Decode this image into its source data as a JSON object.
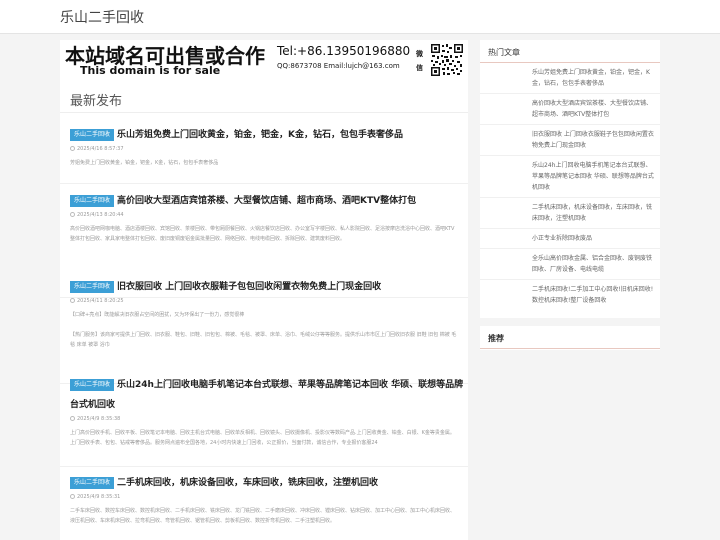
{
  "site": {
    "title": "乐山二手回收"
  },
  "banner": {
    "cn": "本站域名可出售或合作",
    "en": "This domain is for sale",
    "tel": "Tel:+86.13950196880",
    "qq": "QQ:8673708 Email:lujch@163.com",
    "wechat": "微信"
  },
  "section": {
    "title": "最新发布"
  },
  "articles": [
    {
      "tag": "乐山二手回收",
      "title": "乐山芳姐免费上门回收黄金，铂金，钯金，K金，钻石，包包手表奢侈品",
      "date": "2025/4/16 8:57:37",
      "excerpt": "芳姐免费上门回收黄金，铂金，钯金，K金，钻石，包包手表奢侈品"
    },
    {
      "tag": "乐山二手回收",
      "title": "高价回收大型酒店宾馆茶楼、大型餐饮店铺、超市商场、酒吧KTV整体打包",
      "date": "2025/4/13 8:20:44",
      "excerpt": "高价回收酒吧网咖电脑、酒店酒楼回收、宾馆回收、茶楼回收、带包厢厨餐回收、火锅店餐饮店回收、办公室写字楼回收、私人影院回收、足浴按摩店洗浴中心回收、酒吧KTV整体打包回收、家具家电整体打包回收、废旧废铜废铝金属批量回收、网络回收、电线电缆回收、拆除回收、建筑废料回收。"
    },
    {
      "tag": "乐山二手回收",
      "title": "旧衣服回收 上门回收衣服鞋子包包回收闲置衣物免费上门现金回收",
      "date": "2025/4/11 8:20:25",
      "excerpt": "【口碑+亮点】既能解决旧衣服占空间的困扰，又为环保出了一份力，感觉很棒\n\n【热门服务】该商家可提供上门回收、旧衣服、鞋包、旧鞋、旧包包、棉被、毛毯、被罩、床单、浴巾、毛绒公仔等等服务。提供乐山市市区上门回收旧衣服 旧鞋 旧包 棉被 毛毯 床单 被罩 浴巾"
    },
    {
      "tag": "乐山二手回收",
      "title": "乐山24h上门回收电脑手机笔记本台式联想、苹果等品牌笔记本回收 华硕、联想等品牌台式机回收",
      "date": "2025/4/9 8:35:38",
      "excerpt": "上门高价回收手机、回收平板、回收笔记本电脑、回收主机台式电脑、回收单反相机、回收镜头、回收摄像机、投影仪等数码产品.上门回收黄金、铂金、白银、K金等贵金属。上门回收手表、包包、钻戒等奢侈品。服务网点遍布全国各地，24小时内快速上门回收，公正报价，当面付款，诚信合作，专业报价客服24"
    },
    {
      "tag": "乐山二手回收",
      "title": "二手机床回收，机床设备回收，车床回收，铣床回收，注塑机回收",
      "date": "2025/4/9 8:35:31",
      "excerpt": "二手车床回收、数控车床回收、数控机床回收、二手机床回收、铣床回收、龙门铣回收、二手磨床回收、冲床回收、镗床回收、钻床回收、加工中心回收、加工中心机床回收、液压机回收、车床机床回收、拉弯机回收、弯管机回收、锯管机回收、剪板机回收、数控折弯机回收、二手注塑机回收。"
    }
  ],
  "sidebar": {
    "hot_title": "热门文章",
    "hot_items": [
      "乐山芳姐免费上门回收黄金，铂金，钯金，K金，钻石，包包手表奢侈品",
      "高价回收大型酒店宾馆茶楼、大型餐饮店铺、超市商场、酒吧KTV整体打包",
      "旧衣服回收 上门回收衣服鞋子包包回收闲置衣物免费上门现金回收",
      "乐山24h上门回收电脑手机笔记本台式联想、苹果等品牌笔记本回收 华硕、联想等品牌台式机回收",
      "二手机床回收，机床设备回收，车床回收，铣床回收，注塑机回收",
      "小正专业拆除回收废品",
      "全乐山高价回收金属、铝合金回收、废铜废铁回收、厂房设备、电线电缆",
      "二手机床回收!二手加工中心回收!旧机床回收!数控机床回收!整厂设备回收"
    ],
    "rec_title": "推荐"
  }
}
